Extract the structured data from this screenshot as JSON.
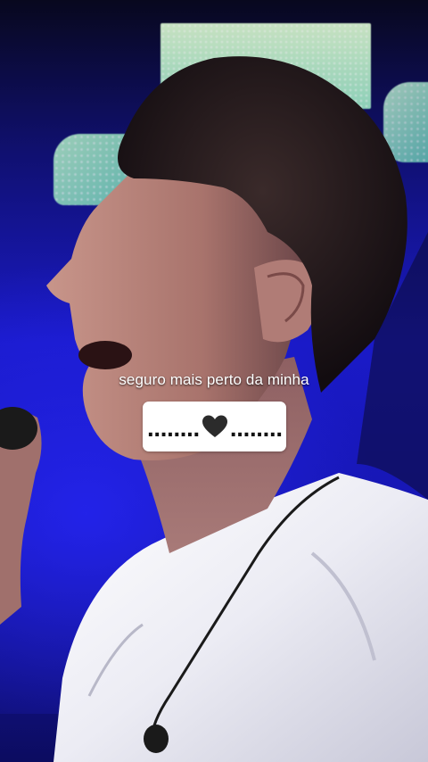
{
  "video": {
    "caption": "seguro mais perto da minha",
    "lyric_box": {
      "left_dots": "........",
      "icon": "black-heart-icon",
      "right_dots": "........"
    }
  },
  "colors": {
    "stage_blue": "#1a1ac8",
    "led_green": "#98e0c0",
    "shirt_white": "#f0f0f0",
    "caption_text": "#ffffff",
    "box_bg": "#ffffff",
    "heart": "#2b2b2b"
  }
}
